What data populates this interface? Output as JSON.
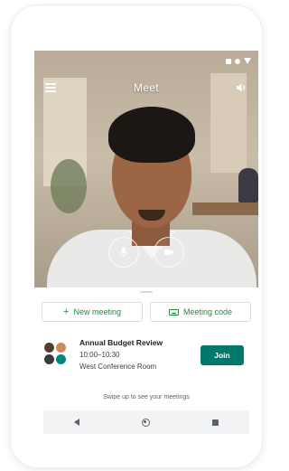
{
  "app": {
    "title": "Meet"
  },
  "video": {
    "menu_icon": "menu-icon",
    "sound_icon": "volume-icon",
    "mic_icon": "microphone-icon",
    "camera_icon": "videocam-icon"
  },
  "actions": {
    "new_meeting_label": "New meeting",
    "new_meeting_icon": "plus-icon",
    "meeting_code_label": "Meeting code",
    "meeting_code_icon": "keyboard-icon",
    "accent_color": "#1e8e3e"
  },
  "meeting": {
    "title": "Annual Budget Review",
    "time": "10:00–10:30",
    "room": "West Conference Room",
    "join_label": "Join",
    "join_color": "#00796b"
  },
  "hint": {
    "text": "Swipe up to see your meetings"
  },
  "navigation": {
    "back_icon": "back-triangle-icon",
    "home_icon": "home-circle-icon",
    "recent_icon": "recent-square-icon"
  }
}
